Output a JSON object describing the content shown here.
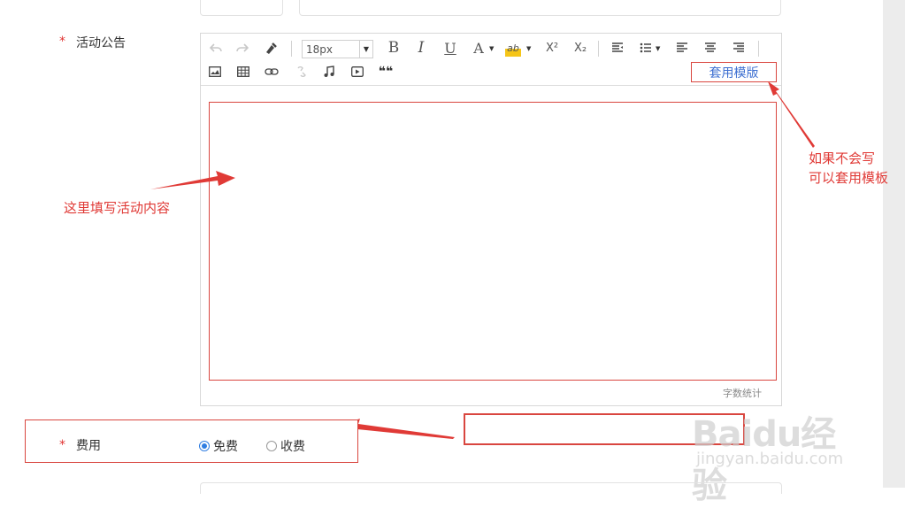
{
  "form": {
    "announcement": {
      "required_mark": "*",
      "label": "活动公告"
    },
    "fee": {
      "required_mark": "*",
      "label": "费用",
      "options": [
        {
          "label": "免费",
          "checked": true
        },
        {
          "label": "收费",
          "checked": false
        }
      ]
    }
  },
  "editor": {
    "toolbar": {
      "font_size": "18px",
      "bold": "B",
      "italic": "I",
      "underline": "U",
      "font_color": "A",
      "highlight": "ab",
      "superscript": "X²",
      "subscript": "X₂",
      "quote": "❝❝",
      "template_button": "套用模版"
    },
    "word_count": "字数统计"
  },
  "annotations": {
    "content_hint": "这里填写活动内容",
    "template_hint_line1": "如果不会写",
    "template_hint_line2": "可以套用模板"
  },
  "watermark": {
    "logo": "Baidu经验",
    "url": "jingyan.baidu.com"
  },
  "colors": {
    "annotation_red": "#e03a36",
    "radio_blue": "#2f7de1",
    "link_blue": "#3d6fd1"
  }
}
